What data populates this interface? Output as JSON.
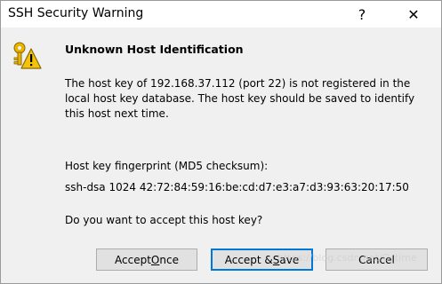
{
  "window": {
    "title": "SSH Security Warning",
    "help_glyph": "?",
    "close_glyph": "✕"
  },
  "dialog": {
    "heading": "Unknown Host Identification",
    "message_lines": [
      "The host key of 192.168.37.112 (port 22) is not registered in the",
      "local host key database. The host key should be saved to identify",
      "this host next time."
    ],
    "fingerprint_label": "Host key fingerprint (MD5 checksum):",
    "fingerprint_value": "ssh-dsa 1024 42:72:84:59:16:be:cd:d7:e3:a7:d3:93:63:20:17:50",
    "question": "Do you want to accept this host key?"
  },
  "buttons": {
    "accept_once": {
      "pre": "Accept ",
      "ul": "O",
      "post": "nce"
    },
    "accept_save": {
      "pre": "Accept & ",
      "ul": "S",
      "post": "ave"
    },
    "cancel": {
      "pre": "Cancel",
      "ul": "",
      "post": ""
    },
    "default_focus_color": "#0078d7"
  },
  "icons": {
    "dialog_icon": "key-warning-icon"
  },
  "watermark": "https://blog.csdn.net/O_time"
}
